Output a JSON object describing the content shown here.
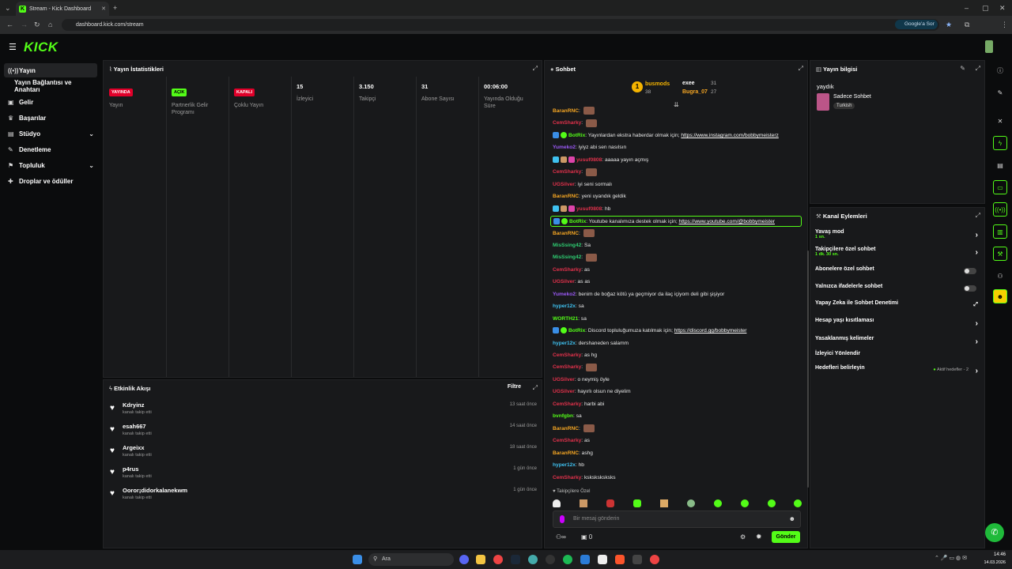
{
  "browser": {
    "tab_title": "Stream - Kick Dashboard",
    "url": "dashboard.kick.com/stream",
    "google_pill": "Google'a Sor"
  },
  "app": {
    "logo": "KICK"
  },
  "sidebar": {
    "items": [
      {
        "label": "Yayın",
        "icon": "broadcast-icon"
      },
      {
        "label": "Yayın Bağlantısı ve Anahtarı",
        "icon": ""
      },
      {
        "label": "Gelir",
        "icon": "wallet-icon"
      },
      {
        "label": "Başarılar",
        "icon": "trophy-icon"
      },
      {
        "label": "Stüdyo",
        "icon": "studio-icon"
      },
      {
        "label": "Denetleme",
        "icon": "wrench-icon"
      },
      {
        "label": "Topluluk",
        "icon": "community-icon"
      },
      {
        "label": "Droplar ve ödüller",
        "icon": "gift-icon"
      }
    ]
  },
  "stats": {
    "title": "Yayın İstatistikleri",
    "items": [
      {
        "badge": "YAYINDA",
        "badge_color": "#e0002a",
        "label": "Yayın"
      },
      {
        "badge": "AÇIK",
        "badge_color": "#53fc18",
        "label": "Partnerlik Gelir Programı"
      },
      {
        "badge": "KAPALI",
        "badge_color": "#e0002a",
        "label": "Çoklu Yayın"
      },
      {
        "value": "15",
        "label": "İzleyici"
      },
      {
        "value": "3.150",
        "label": "Takipçi"
      },
      {
        "value": "31",
        "label": "Abone Sayısı"
      },
      {
        "value": "00:06:00",
        "label": "Yayında Olduğu Süre"
      }
    ]
  },
  "activity": {
    "title": "Etkinlik Akışı",
    "filter": "Filtre",
    "items": [
      {
        "name": "Kdryinz",
        "sub": "kanalı takip etti",
        "time": "13 saat önce"
      },
      {
        "name": "esah667",
        "sub": "kanalı takip etti",
        "time": "14 saat önce"
      },
      {
        "name": "Argeixx",
        "sub": "kanalı takip etti",
        "time": "18 saat önce"
      },
      {
        "name": "p4rus",
        "sub": "kanalı takip etti",
        "time": "1 gün önce"
      },
      {
        "name": "Ooror¡didorkalanekwm",
        "sub": "kanalı takip etti",
        "time": "1 gün önce"
      }
    ]
  },
  "chat": {
    "title": "Sohbet",
    "leaders": {
      "first_name": "busmods",
      "first_count": "38",
      "second_name": "exee",
      "second_count": "31",
      "third_name": "Bugra_07",
      "third_count": "27"
    },
    "messages": [
      {
        "user": "BaranRNC",
        "color": "#f5a623",
        "text": "",
        "emote": true
      },
      {
        "user": "CemSharky",
        "color": "#e0314b",
        "text": "",
        "emote": true
      },
      {
        "user": "BotRix",
        "color": "#53fc18",
        "text": "Yayınlardan ekstra haberdar olmak için; ",
        "link": "https://www.instagram.com/bobbymeisterz",
        "bot": true
      },
      {
        "user": "Yumeko2",
        "color": "#9b59f5",
        "text": "iyiyz abi sen nasılsın"
      },
      {
        "user": "yusuf0808",
        "color": "#e0314b",
        "text": "aaaaa yayın açmış",
        "badges": true
      },
      {
        "user": "CemSharky",
        "color": "#e0314b",
        "text": "",
        "emote": true
      },
      {
        "user": "UGSilver",
        "color": "#e0314b",
        "text": "iyi seni sormalı"
      },
      {
        "user": "BaranRNC",
        "color": "#f5a623",
        "text": "yeni uyandık geldik"
      },
      {
        "user": "yusuf0808",
        "color": "#e0314b",
        "text": "hb",
        "badges": true
      },
      {
        "user": "BotRix",
        "color": "#53fc18",
        "text": "Youtube kanalımıza destek olmak için; ",
        "link": "https://www.youtube.com/@bobbymeister",
        "bot": true,
        "highlight": true
      },
      {
        "user": "BaranRNC",
        "color": "#f5a623",
        "text": "",
        "emote": true
      },
      {
        "user": "MisSsing42",
        "color": "#2ecc71",
        "text": "Sa"
      },
      {
        "user": "MisSsing42",
        "color": "#2ecc71",
        "text": "",
        "emote": true
      },
      {
        "user": "CemSharky",
        "color": "#e0314b",
        "text": "as"
      },
      {
        "user": "UGSilver",
        "color": "#e0314b",
        "text": "as as"
      },
      {
        "user": "Yumeko2",
        "color": "#9b59f5",
        "text": "benim de boğaz kötü ya geçmiyor da ilaç içiyom deli gibi şişiyor"
      },
      {
        "user": "hyper12x",
        "color": "#3fc1f0",
        "text": "sa"
      },
      {
        "user": "WORTH21",
        "color": "#53fc18",
        "text": "sa"
      },
      {
        "user": "BotRix",
        "color": "#53fc18",
        "text": "Discord topluluğumuza katılmak için; ",
        "link": "https://discord.gg/bobbymeister",
        "bot": true
      },
      {
        "user": "hyper12x",
        "color": "#3fc1f0",
        "text": "dershaneden salamm"
      },
      {
        "user": "CemSharky",
        "color": "#e0314b",
        "text": "as hg"
      },
      {
        "user": "CemSharky",
        "color": "#e0314b",
        "text": "",
        "emote": true
      },
      {
        "user": "UGSilver",
        "color": "#e0314b",
        "text": "o neymiş öyle"
      },
      {
        "user": "UGSilver",
        "color": "#e0314b",
        "text": "hayırlı olsun ne diyelim"
      },
      {
        "user": "CemSharky",
        "color": "#e0314b",
        "text": "harbi abi"
      },
      {
        "user": "bvnfgbn",
        "color": "#53fc18",
        "text": "sa"
      },
      {
        "user": "BaranRNC",
        "color": "#f5a623",
        "text": "",
        "emote": true
      },
      {
        "user": "CemSharky",
        "color": "#e0314b",
        "text": "as"
      },
      {
        "user": "BaranRNC",
        "color": "#f5a623",
        "text": "ashg"
      },
      {
        "user": "hyper12x",
        "color": "#3fc1f0",
        "text": "hb"
      },
      {
        "user": "CemSharky",
        "color": "#e0314b",
        "text": "ksksksksksks"
      }
    ],
    "followers_only": "Takipçilere Özel",
    "input_placeholder": "Bir mesaj gönderin",
    "send": "Gönder",
    "points": "0"
  },
  "stream_info": {
    "title": "Yayın bilgisi",
    "stream_title": "yaydık",
    "category": "Sadece Sohbet",
    "tag": "Turkish"
  },
  "channel_actions": {
    "title": "Kanal Eylemleri",
    "items": [
      {
        "label": "Yavaş mod",
        "sub": "1 sn.",
        "control": "arrow"
      },
      {
        "label": "Takipçilere özel sohbet",
        "sub": "1 dk. 30 sn.",
        "control": "arrow"
      },
      {
        "label": "Abonelere özel sohbet",
        "sub": "",
        "control": "toggle"
      },
      {
        "label": "Yalnızca ifadelerle sohbet",
        "sub": "",
        "control": "toggle"
      },
      {
        "label": "Yapay Zeka ile Sohbet Denetimi",
        "sub": "",
        "control": "external"
      },
      {
        "label": "Hesap yaşı kısıtlaması",
        "sub": "",
        "control": "arrow"
      },
      {
        "label": "Yasaklanmış kelimeler",
        "sub": "",
        "control": "arrow"
      },
      {
        "label": "İzleyici Yönlendir",
        "sub": "",
        "control": "none"
      },
      {
        "label": "Hedefleri belirleyin",
        "sub": "",
        "control": "arrow",
        "extra": "Aktif hedefler - 2"
      }
    ]
  },
  "taskbar": {
    "search": "Ara",
    "time": "14:46",
    "date": "14.03.2026"
  }
}
